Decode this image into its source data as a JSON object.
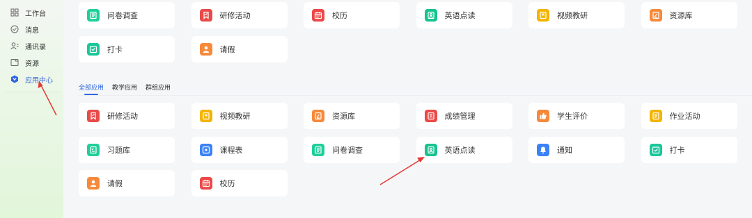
{
  "sidebar": {
    "items": [
      {
        "label": "工作台",
        "icon": "grid-icon"
      },
      {
        "label": "消息",
        "icon": "check-circle-icon"
      },
      {
        "label": "通讯录",
        "icon": "contacts-icon"
      },
      {
        "label": "资源",
        "icon": "folder-icon"
      },
      {
        "label": "应用中心",
        "icon": "app-center-icon"
      }
    ]
  },
  "colors": {
    "accent": "#2f66e0",
    "annotation_arrow": "#e53935"
  },
  "top_apps": [
    {
      "label": "问卷调查",
      "icon": "questionnaire-icon",
      "color": "#1fcf9a"
    },
    {
      "label": "研修活动",
      "icon": "ribbon-icon",
      "color": "#e84a4a"
    },
    {
      "label": "校历",
      "icon": "calendar-icon",
      "color": "#ec4848"
    },
    {
      "label": "英语点读",
      "icon": "book-reader-icon",
      "color": "#17c28f"
    },
    {
      "label": "视频教研",
      "icon": "bookmark-icon",
      "color": "#f4b400"
    },
    {
      "label": "资源库",
      "icon": "pencil-note-icon",
      "color": "#f7893a"
    },
    {
      "label": "打卡",
      "icon": "checkin-icon",
      "color": "#19c79a"
    },
    {
      "label": "请假",
      "icon": "person-icon",
      "color": "#f7893a"
    }
  ],
  "tabs": [
    "全部应用",
    "教学应用",
    "群组应用"
  ],
  "all_apps": [
    {
      "label": "研修活动",
      "icon": "ribbon-icon",
      "color": "#e84a4a"
    },
    {
      "label": "视频教研",
      "icon": "bookmark-icon",
      "color": "#f4b400"
    },
    {
      "label": "资源库",
      "icon": "pencil-note-icon",
      "color": "#f7893a"
    },
    {
      "label": "成绩管理",
      "icon": "score-icon",
      "color": "#ec4848"
    },
    {
      "label": "学生评价",
      "icon": "thumbs-up-icon",
      "color": "#f7893a"
    },
    {
      "label": "作业活动",
      "icon": "homework-icon",
      "color": "#f4b400"
    },
    {
      "label": "习题库",
      "icon": "exercise-icon",
      "color": "#1fcf9a"
    },
    {
      "label": "课程表",
      "icon": "schedule-icon",
      "color": "#3b82f6"
    },
    {
      "label": "问卷调查",
      "icon": "questionnaire-icon",
      "color": "#1fcf9a"
    },
    {
      "label": "英语点读",
      "icon": "book-reader-icon",
      "color": "#17c28f"
    },
    {
      "label": "通知",
      "icon": "bell-icon",
      "color": "#3b82f6"
    },
    {
      "label": "打卡",
      "icon": "checkin-icon",
      "color": "#19c79a"
    },
    {
      "label": "请假",
      "icon": "person-icon",
      "color": "#f7893a"
    },
    {
      "label": "校历",
      "icon": "calendar-icon",
      "color": "#ec4848"
    }
  ]
}
